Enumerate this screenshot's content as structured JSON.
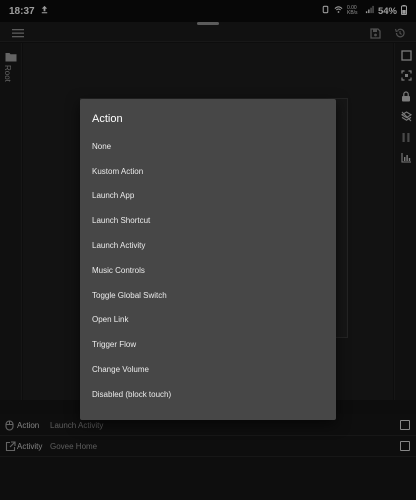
{
  "status_bar": {
    "time": "18:37",
    "battery": "54%",
    "network_speed_label": "0.00 KB/s"
  },
  "left_rail": {
    "root_label": "Root"
  },
  "dialog": {
    "title": "Action",
    "options": [
      "None",
      "Kustom Action",
      "Launch App",
      "Launch Shortcut",
      "Launch Activity",
      "Music Controls",
      "Toggle Global Switch",
      "Open Link",
      "Trigger Flow",
      "Change Volume",
      "Disabled (block touch)"
    ]
  },
  "properties": [
    {
      "label": "Action",
      "value": "Launch Activity",
      "icon": "mouse-icon"
    },
    {
      "label": "Activity",
      "value": "Govee Home",
      "icon": "external-link-icon"
    }
  ],
  "colors": {
    "background": "#141414",
    "dialog_bg": "#474747",
    "text": "#ececec"
  }
}
